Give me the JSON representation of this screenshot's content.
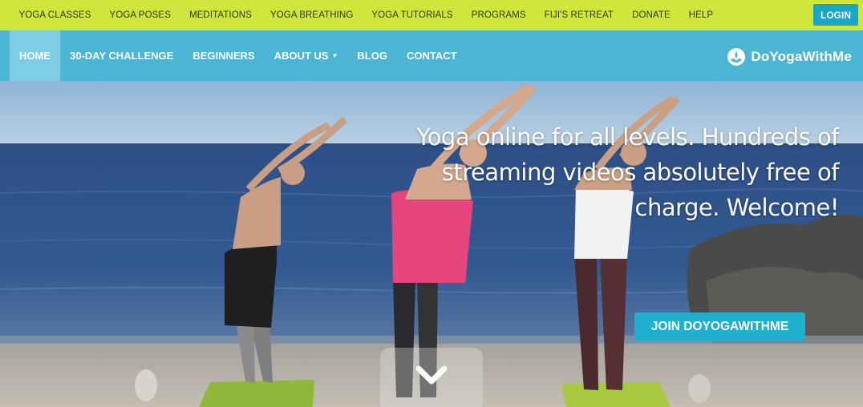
{
  "topbar": {
    "links": [
      "YOGA CLASSES",
      "YOGA POSES",
      "MEDITATIONS",
      "YOGA BREATHING",
      "YOGA TUTORIALS",
      "PROGRAMS",
      "FIJI'S RETREAT",
      "DONATE",
      "HELP"
    ],
    "login_label": "LOGIN"
  },
  "mainnav": {
    "items": [
      {
        "label": "HOME",
        "active": true
      },
      {
        "label": "30-DAY CHALLENGE"
      },
      {
        "label": "BEGINNERS"
      },
      {
        "label": "ABOUT US",
        "has_dropdown": true
      },
      {
        "label": "BLOG"
      },
      {
        "label": "CONTACT"
      }
    ],
    "brand_text": "DoYogaWithMe",
    "brand_icon": "lotus-logo-icon"
  },
  "hero": {
    "tagline": "Yoga online for all levels. Hundreds of streaming videos absolutely free of charge. Welcome!",
    "join_label": "JOIN DOYOGAWITHME",
    "scroll_icon": "chevron-down-icon"
  },
  "colors": {
    "topbar_bg": "#cfe63a",
    "nav_bg": "#4cb5d4",
    "nav_active_bg": "#7fcde4",
    "accent_button": "#1fb0cf",
    "login_button": "#18a6c9"
  }
}
